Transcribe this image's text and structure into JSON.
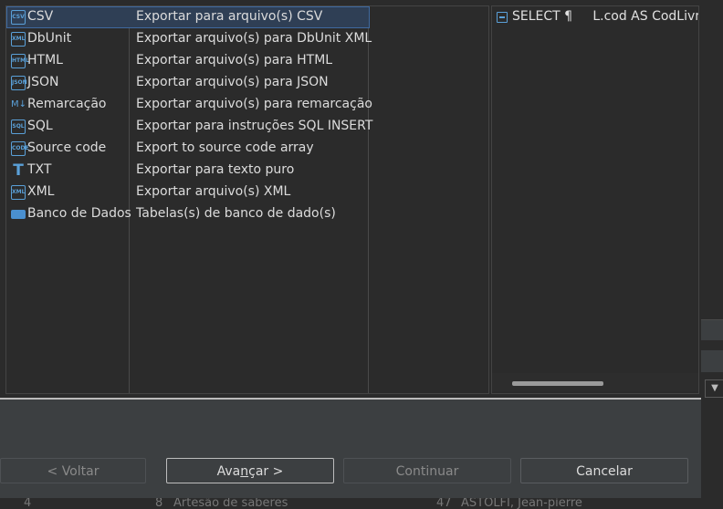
{
  "formats": [
    {
      "name": "CSV",
      "description": "Exportar para arquivo(s) CSV",
      "icon": "csv-file-icon",
      "badge": "CSV"
    },
    {
      "name": "DbUnit",
      "description": "Exportar arquivo(s) para DbUnit XML",
      "icon": "xml-file-icon",
      "badge": "XML"
    },
    {
      "name": "HTML",
      "description": "Exportar arquivo(s) para HTML",
      "icon": "html-file-icon",
      "badge": "HTML"
    },
    {
      "name": "JSON",
      "description": "Exportar arquivo(s) para JSON",
      "icon": "json-file-icon",
      "badge": "JSON"
    },
    {
      "name": "Remarcação",
      "description": "Exportar arquivo(s) para remarcação",
      "icon": "markdown-icon",
      "badge": "M↓"
    },
    {
      "name": "SQL",
      "description": "Exportar para instruções SQL INSERT",
      "icon": "sql-file-icon",
      "badge": "SQL"
    },
    {
      "name": "Source code",
      "description": "Export to source code array",
      "icon": "code-file-icon",
      "badge": "CODE"
    },
    {
      "name": "TXT",
      "description": "Exportar para texto puro",
      "icon": "text-icon",
      "badge": "T"
    },
    {
      "name": "XML",
      "description": "Exportar  arquivo(s) XML",
      "icon": "xml-file-icon",
      "badge": "XML"
    },
    {
      "name": "Banco de Dados",
      "description": "Tabelas(s) de banco de dado(s)",
      "icon": "database-icon",
      "badge": ""
    }
  ],
  "selected_index": 0,
  "preview": {
    "text": "SELECT ¶     L.cod AS CodLivro, \\",
    "icon": "sql-query-icon"
  },
  "buttons": {
    "back": "< Voltar",
    "next_pre": "Ava",
    "next_mnemonic": "n",
    "next_post": "çar >",
    "continue": "Continuar",
    "cancel": "Cancelar"
  },
  "background": {
    "row_num": "4",
    "row_id": "8",
    "row_title": "Artesão de saberes",
    "row_num2": "47",
    "row_author": "ASTOLFI, Jean-pierre",
    "combo_arrow": "▼"
  },
  "colors": {
    "accent": "#5aa0d8",
    "selection": "#2f3f55",
    "selection_border": "#3f6aa0"
  }
}
